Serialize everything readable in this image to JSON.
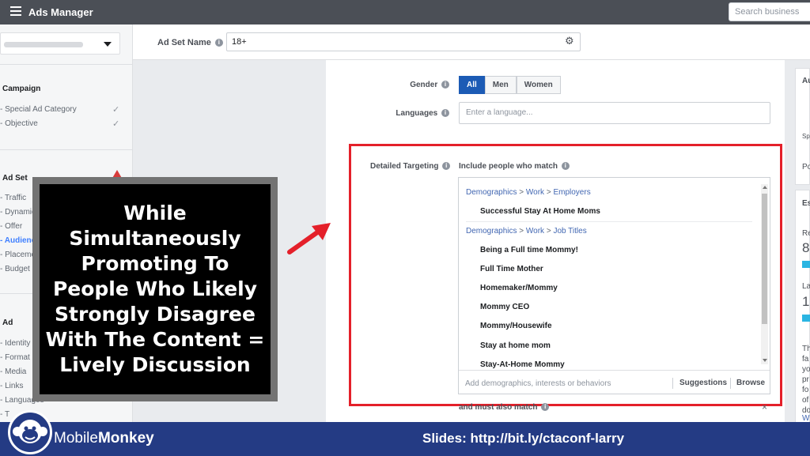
{
  "topbar": {
    "title": "Ads Manager",
    "search_placeholder": "Search business"
  },
  "sidebar": {
    "campaign_title": "Campaign",
    "campaign_items": [
      "Special Ad Category",
      "Objective"
    ],
    "adset_title": "Ad Set",
    "adset_items": [
      "Traffic",
      "Dynamic",
      "Offer",
      "Audience",
      "Placements",
      "Budget"
    ],
    "ad_title": "Ad",
    "ad_items": [
      "Identity",
      "Format",
      "Media",
      "Links",
      "Languages",
      "T"
    ]
  },
  "adset_name": {
    "label": "Ad Set Name",
    "value": "18+"
  },
  "form": {
    "gender_label": "Gender",
    "gender_options": [
      "All",
      "Men",
      "Women"
    ],
    "gender_selected": "All",
    "languages_label": "Languages",
    "languages_placeholder": "Enter a language..."
  },
  "targeting": {
    "label": "Detailed Targeting",
    "include_label": "Include people who match",
    "groups": [
      {
        "path": [
          "Demographics",
          "Work",
          "Employers"
        ],
        "items": [
          "Successful Stay At Home Moms"
        ]
      },
      {
        "path": [
          "Demographics",
          "Work",
          "Job Titles"
        ],
        "items": [
          "Being a Full time Mommy!",
          "Full Time Mother",
          "Homemaker/Mommy",
          "Mommy CEO",
          "Mommy/Housewife",
          "Stay at home mom",
          "Stay-At-Home Mommy"
        ]
      }
    ],
    "add_placeholder": "Add demographics, interests or behaviors",
    "suggestions_label": "Suggestions",
    "browse_label": "Browse",
    "must_match_label": "and must also match",
    "close_icon": "×"
  },
  "right_panel": {
    "letters": [
      "Au",
      "Sp",
      "Po",
      "Es",
      "Re",
      "8",
      "La",
      "1",
      "Th",
      "fa",
      "yo",
      "pr",
      "fo",
      "of",
      "do",
      "W"
    ]
  },
  "overlay": {
    "lines": [
      "While",
      "Simultaneously",
      "Promoting To",
      "People Who Likely",
      "Strongly Disagree",
      "With The Content =",
      "Lively Discussion"
    ]
  },
  "banner": {
    "brand_light": "Mobile",
    "brand_bold": "Monkey",
    "slides_text": "Slides: http://bit.ly/ctaconf-larry"
  },
  "colors": {
    "accent_red": "#e4202a",
    "banner_blue": "#243b84",
    "link_blue": "#4267b2"
  }
}
